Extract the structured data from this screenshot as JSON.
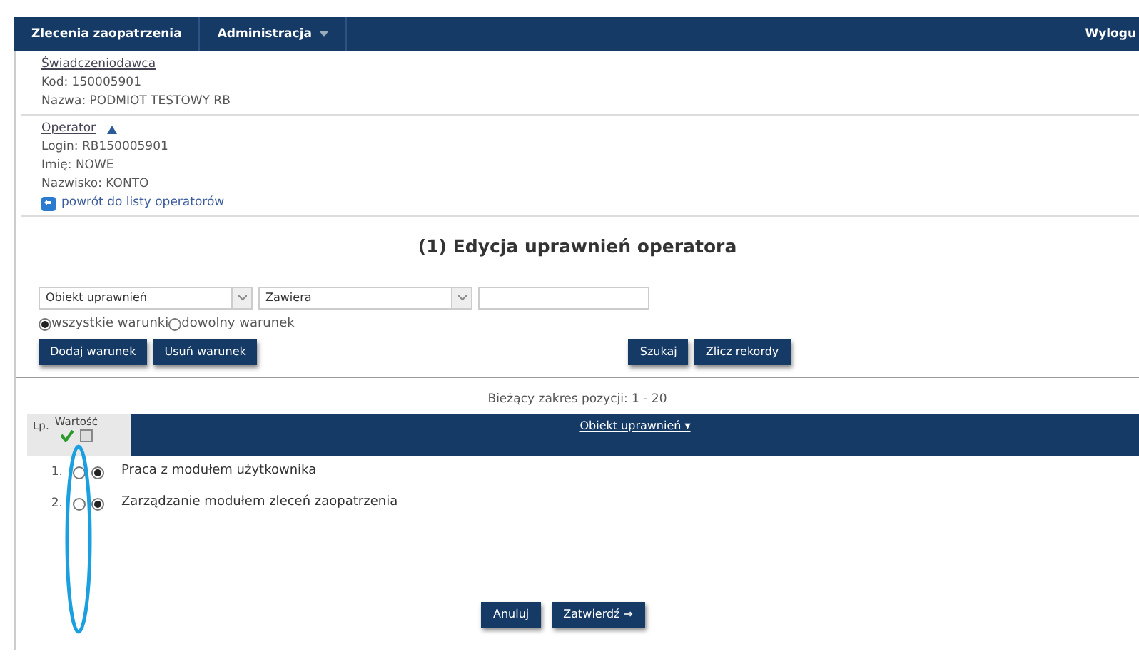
{
  "navbar": {
    "items": [
      {
        "label": "Zlecenia zaopatrzenia",
        "dropdown": false
      },
      {
        "label": "Administracja",
        "dropdown": true
      }
    ],
    "logout": "Wylogu"
  },
  "provider": {
    "heading": "Świadczeniodawca",
    "lines": [
      "Kod: 150005901",
      "Nazwa: PODMIOT TESTOWY RB"
    ]
  },
  "operator": {
    "heading": "Operator",
    "lines": [
      "Login: RB150005901",
      "Imię: NOWE",
      "Nazwisko: KONTO"
    ],
    "back_link": "powrót do listy operatorów"
  },
  "title": "(1) Edycja uprawnień operatora",
  "filter": {
    "field": "Obiekt uprawnień",
    "operator": "Zawiera",
    "mode_options": [
      {
        "label": "wszystkie warunki",
        "selected": true
      },
      {
        "label": "dowolny warunek",
        "selected": false
      }
    ]
  },
  "filter_buttons": [
    "Dodaj warunek",
    "Usuń warunek"
  ],
  "search_buttons": [
    "Szukaj",
    "Zlicz rekordy"
  ],
  "range": "Bieżący zakres pozycji: 1 - 20",
  "table": {
    "columns": [
      "Lp.",
      "Wartość",
      "Obiekt uprawnień ▾"
    ],
    "select_all_checked": false,
    "rows": [
      {
        "index": "1.",
        "value_on": false,
        "value_off": true,
        "name": "Praca z modułem użytkownika"
      },
      {
        "index": "2.",
        "value_on": false,
        "value_off": true,
        "name": "Zarządzanie modułem zleceń zaopatrzenia"
      }
    ]
  },
  "footer_buttons": [
    "Anuluj",
    "Zatwierdź →"
  ]
}
